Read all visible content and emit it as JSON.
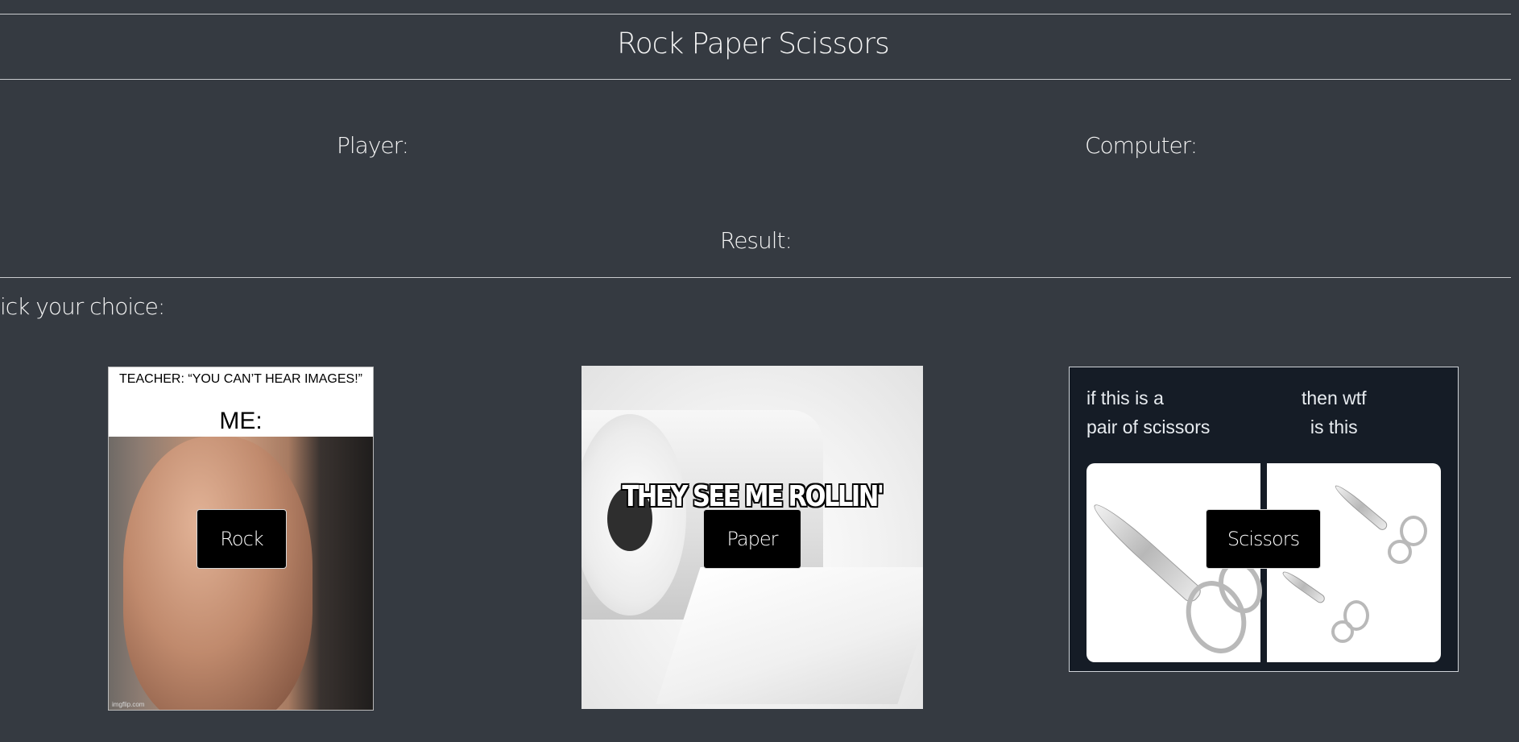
{
  "header": {
    "title": "Rock Paper Scissors"
  },
  "scoreboard": {
    "player_label": "Player:",
    "computer_label": "Computer:",
    "result_label": "Result:"
  },
  "prompt": {
    "text": "ick your choice:"
  },
  "choices": [
    {
      "button_label": "Rock",
      "image": {
        "caption": "TEACHER: “YOU CAN’T HEAR IMAGES!”",
        "subcaption": "ME:",
        "watermark": "imgflip.com"
      }
    },
    {
      "button_label": "Paper",
      "image": {
        "meme_text": "THEY SEE ME ROLLIN'"
      }
    },
    {
      "button_label": "Scissors",
      "image": {
        "left_text": [
          "if this is a",
          "pair of scissors"
        ],
        "right_text": [
          "then wtf",
          "is this"
        ]
      }
    }
  ]
}
